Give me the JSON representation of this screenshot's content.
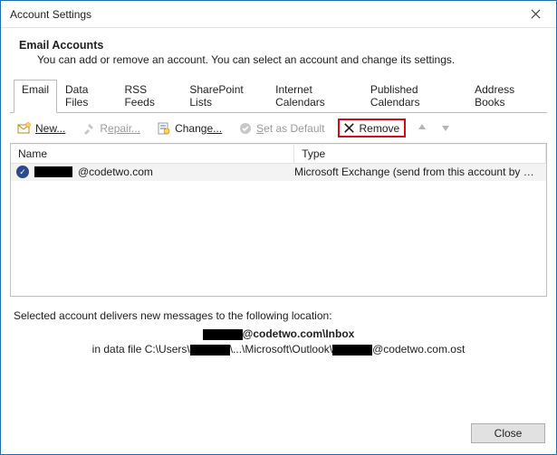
{
  "window": {
    "title": "Account Settings"
  },
  "header": {
    "title": "Email Accounts",
    "subtitle": "You can add or remove an account. You can select an account and change its settings."
  },
  "tabs": [
    {
      "label": "Email"
    },
    {
      "label": "Data Files"
    },
    {
      "label": "RSS Feeds"
    },
    {
      "label": "SharePoint Lists"
    },
    {
      "label": "Internet Calendars"
    },
    {
      "label": "Published Calendars"
    },
    {
      "label": "Address Books"
    }
  ],
  "toolbar": {
    "new": "New...",
    "repair1": "R",
    "repair2": "epair...",
    "change1": "Chang",
    "change2": "e...",
    "default1": "S",
    "default2": "et as Default",
    "remove1": "Re",
    "remove2": "m",
    "remove3": "ove"
  },
  "grid": {
    "colName": "Name",
    "colType": "Type",
    "rows": [
      {
        "name": "@codetwo.com",
        "type": "Microsoft Exchange (send from this account by def..."
      }
    ]
  },
  "location": {
    "intro": "Selected account delivers new messages to the following location:",
    "mailbox_suffix": "@codetwo.com\\Inbox",
    "path_pre": "in data file C:\\Users\\",
    "path_mid": "\\...\\Microsoft\\Outlook\\",
    "path_suffix": "@codetwo.com.ost"
  },
  "footer": {
    "close": "Close"
  }
}
